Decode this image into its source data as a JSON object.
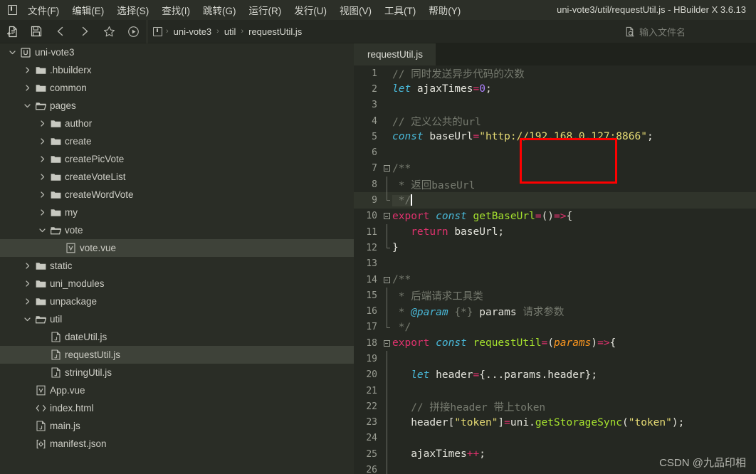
{
  "window": {
    "title": "uni-vote3/util/requestUtil.js - HBuilder X 3.6.13",
    "logo_icon": "hbuilder-logo-icon"
  },
  "menubar": {
    "items": [
      {
        "label": "文件(F)",
        "name": "menu-file"
      },
      {
        "label": "编辑(E)",
        "name": "menu-edit"
      },
      {
        "label": "选择(S)",
        "name": "menu-select"
      },
      {
        "label": "查找(I)",
        "name": "menu-find"
      },
      {
        "label": "跳转(G)",
        "name": "menu-goto"
      },
      {
        "label": "运行(R)",
        "name": "menu-run"
      },
      {
        "label": "发行(U)",
        "name": "menu-publish"
      },
      {
        "label": "视图(V)",
        "name": "menu-view"
      },
      {
        "label": "工具(T)",
        "name": "menu-tools"
      },
      {
        "label": "帮助(Y)",
        "name": "menu-help"
      }
    ]
  },
  "toolbar": {
    "buttons": [
      {
        "icon": "new-file-icon"
      },
      {
        "icon": "save-icon"
      },
      {
        "icon": "back-arrow-icon"
      },
      {
        "icon": "forward-arrow-icon"
      },
      {
        "icon": "star-icon"
      },
      {
        "icon": "run-play-icon"
      }
    ],
    "breadcrumb": {
      "project_icon": "project-badge-icon",
      "items": [
        "uni-vote3",
        "util",
        "requestUtil.js"
      ],
      "separator": "›"
    },
    "search": {
      "icon": "file-search-icon",
      "placeholder": "输入文件名",
      "value": ""
    }
  },
  "sidebar": {
    "items": [
      {
        "label": "uni-vote3",
        "depth": 0,
        "type": "project",
        "state": "open",
        "icon": "project-badge-icon",
        "selected": false
      },
      {
        "label": ".hbuilderx",
        "depth": 1,
        "type": "folder",
        "state": "closed",
        "icon": "folder-icon",
        "selected": false
      },
      {
        "label": "common",
        "depth": 1,
        "type": "folder",
        "state": "closed",
        "icon": "folder-icon",
        "selected": false
      },
      {
        "label": "pages",
        "depth": 1,
        "type": "folder",
        "state": "open",
        "icon": "folder-open-icon",
        "selected": false
      },
      {
        "label": "author",
        "depth": 2,
        "type": "folder",
        "state": "closed",
        "icon": "folder-icon",
        "selected": false
      },
      {
        "label": "create",
        "depth": 2,
        "type": "folder",
        "state": "closed",
        "icon": "folder-icon",
        "selected": false
      },
      {
        "label": "createPicVote",
        "depth": 2,
        "type": "folder",
        "state": "closed",
        "icon": "folder-icon",
        "selected": false
      },
      {
        "label": "createVoteList",
        "depth": 2,
        "type": "folder",
        "state": "closed",
        "icon": "folder-icon",
        "selected": false
      },
      {
        "label": "createWordVote",
        "depth": 2,
        "type": "folder",
        "state": "closed",
        "icon": "folder-icon",
        "selected": false
      },
      {
        "label": "my",
        "depth": 2,
        "type": "folder",
        "state": "closed",
        "icon": "folder-icon",
        "selected": false
      },
      {
        "label": "vote",
        "depth": 2,
        "type": "folder",
        "state": "open",
        "icon": "folder-open-icon",
        "selected": false
      },
      {
        "label": "vote.vue",
        "depth": 3,
        "type": "file",
        "state": "none",
        "icon": "vue-file-icon",
        "selected": true
      },
      {
        "label": "static",
        "depth": 1,
        "type": "folder",
        "state": "closed",
        "icon": "folder-icon",
        "selected": false
      },
      {
        "label": "uni_modules",
        "depth": 1,
        "type": "folder",
        "state": "closed",
        "icon": "folder-icon",
        "selected": false
      },
      {
        "label": "unpackage",
        "depth": 1,
        "type": "folder",
        "state": "closed",
        "icon": "folder-icon",
        "selected": false
      },
      {
        "label": "util",
        "depth": 1,
        "type": "folder",
        "state": "open",
        "icon": "folder-open-icon",
        "selected": false
      },
      {
        "label": "dateUtil.js",
        "depth": 2,
        "type": "file",
        "state": "none",
        "icon": "js-file-icon",
        "selected": false
      },
      {
        "label": "requestUtil.js",
        "depth": 2,
        "type": "file",
        "state": "none",
        "icon": "js-file-icon",
        "selected": true
      },
      {
        "label": "stringUtil.js",
        "depth": 2,
        "type": "file",
        "state": "none",
        "icon": "js-file-icon",
        "selected": false
      },
      {
        "label": "App.vue",
        "depth": 1,
        "type": "file",
        "state": "none",
        "icon": "vue-file-icon",
        "selected": false
      },
      {
        "label": "index.html",
        "depth": 1,
        "type": "file",
        "state": "none",
        "icon": "html-file-icon",
        "selected": false
      },
      {
        "label": "main.js",
        "depth": 1,
        "type": "file",
        "state": "none",
        "icon": "js-file-icon",
        "selected": false
      },
      {
        "label": "manifest.json",
        "depth": 1,
        "type": "file",
        "state": "none",
        "icon": "json-file-icon",
        "selected": false
      }
    ]
  },
  "editor": {
    "tabs": [
      {
        "label": "requestUtil.js",
        "active": true
      }
    ],
    "active_line": 9,
    "cursor_line": 9,
    "lines": [
      {
        "n": 1,
        "fold": "",
        "indent": 0
      },
      {
        "n": 2,
        "fold": "",
        "indent": 0
      },
      {
        "n": 3,
        "fold": "",
        "indent": 0
      },
      {
        "n": 4,
        "fold": "",
        "indent": 0
      },
      {
        "n": 5,
        "fold": "",
        "indent": 0
      },
      {
        "n": 6,
        "fold": "",
        "indent": 0
      },
      {
        "n": 7,
        "fold": "box",
        "indent": 0
      },
      {
        "n": 8,
        "fold": "bar",
        "indent": 0
      },
      {
        "n": 9,
        "fold": "barend",
        "indent": 0
      },
      {
        "n": 10,
        "fold": "box",
        "indent": 0
      },
      {
        "n": 11,
        "fold": "bar",
        "indent": 0
      },
      {
        "n": 12,
        "fold": "barend",
        "indent": 0
      },
      {
        "n": 13,
        "fold": "",
        "indent": 0
      },
      {
        "n": 14,
        "fold": "box",
        "indent": 0
      },
      {
        "n": 15,
        "fold": "bar",
        "indent": 0
      },
      {
        "n": 16,
        "fold": "bar",
        "indent": 0
      },
      {
        "n": 17,
        "fold": "barend",
        "indent": 0
      },
      {
        "n": 18,
        "fold": "box",
        "indent": 0
      },
      {
        "n": 19,
        "fold": "bar",
        "indent": 0
      },
      {
        "n": 20,
        "fold": "bar",
        "indent": 0
      },
      {
        "n": 21,
        "fold": "bar",
        "indent": 0
      },
      {
        "n": 22,
        "fold": "bar",
        "indent": 0
      },
      {
        "n": 23,
        "fold": "bar",
        "indent": 0
      },
      {
        "n": 24,
        "fold": "bar",
        "indent": 0
      },
      {
        "n": 25,
        "fold": "bar",
        "indent": 0
      },
      {
        "n": 26,
        "fold": "bar",
        "indent": 0
      }
    ],
    "source_text": [
      "// 同时发送异步代码的次数",
      "let ajaxTimes=0;",
      "",
      "// 定义公共的url",
      "const baseUrl=\"http://192.168.0.127:8866\";",
      "",
      "/**",
      " * 返回baseUrl",
      " */",
      "export const getBaseUrl=()=>{",
      "   return baseUrl;",
      "}",
      "",
      "/**",
      " * 后端请求工具类",
      " * @param {*} params 请求参数",
      " */",
      "export const requestUtil=(params)=>{",
      "",
      "   let header={...params.header};",
      "",
      "   // 拼接header 带上token",
      "   header[\"token\"]=uni.getStorageSync(\"token\");",
      "",
      "   ajaxTimes++;",
      ""
    ]
  },
  "annotation": {
    "type": "red-rectangle",
    "color": "#fe0000",
    "highlights": "192.168.0.127"
  },
  "watermark": {
    "text": "CSDN @九品印相"
  },
  "colors": {
    "window_bg": "#252822",
    "menubar_bg": "#2c2f28",
    "sidebar_bg": "#2a2d26",
    "tabbar_bg": "#1f221c",
    "tab_active_bg": "#2f332b",
    "selection_bg": "#3e4239",
    "active_line_bg": "#30342b",
    "text": "#ccccc4",
    "comment": "#767a6f",
    "keyword": "#e0326e",
    "keyword_alt": "#49b8d8",
    "function": "#a6e22e",
    "string": "#e6db74",
    "number": "#ae81ff",
    "param": "#fd971f",
    "annotation_red": "#fe0000"
  }
}
